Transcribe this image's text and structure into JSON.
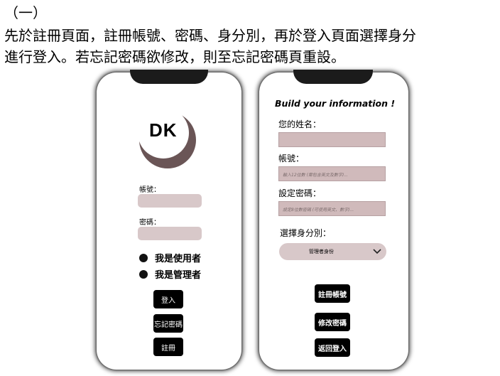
{
  "heading": "（一）",
  "paragraph": [
    "先於註冊頁面，註冊帳號、密碼、身分別，再於登入頁面選擇身分",
    "進行登入。若忘記密碼欲修改，則至忘記密碼頁重設。"
  ],
  "login": {
    "logo_text": "DK",
    "account_label": "帳號：",
    "password_label": "密碼：",
    "role_user": "我是使用者",
    "role_admin": "我是管理者",
    "login_button": "登入",
    "forgot_button": "忘記密碼",
    "register_button": "註冊"
  },
  "register": {
    "title": "Build your information !",
    "name_label": "您的姓名：",
    "account_label": "帳號：",
    "account_placeholder": "輸入12位數 (需包含英文及數字)...",
    "password_label": "設定密碼：",
    "password_placeholder": "設定8位數密碼 (可使用英文、數字)...",
    "role_label": "選擇身分別：",
    "role_selected": "管理者身份",
    "register_button": "註冊帳號",
    "change_password_button": "修改密碼",
    "back_button": "返回登入"
  },
  "colors": {
    "field": "#d8c8c9",
    "logo_ring": "#6a5556"
  }
}
